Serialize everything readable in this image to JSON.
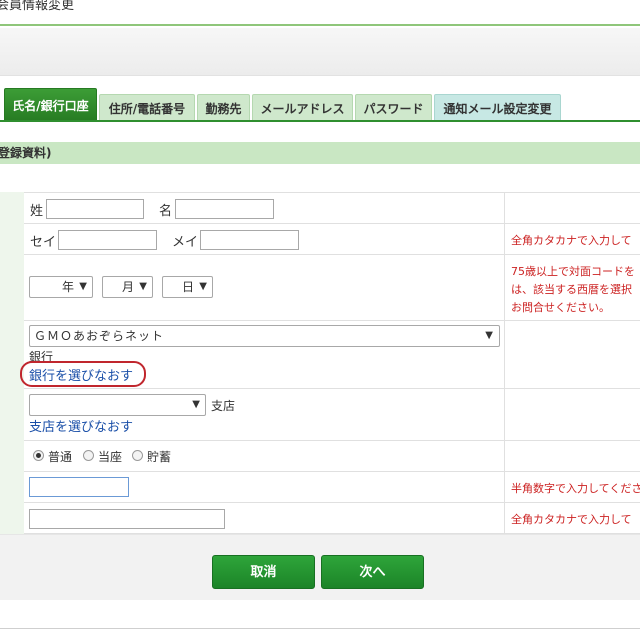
{
  "page": {
    "title": "会員情報変更"
  },
  "tabs": [
    {
      "label": "氏名/銀行口座",
      "active": true
    },
    {
      "label": "住所/電話番号"
    },
    {
      "label": "勤務先"
    },
    {
      "label": "メールアドレス"
    },
    {
      "label": "パスワード"
    },
    {
      "label": "通知メール設定変更"
    }
  ],
  "section": {
    "heading": "登録資料)"
  },
  "name_row": {
    "sei_label": "姓",
    "mei_label": "名",
    "sei_value": "",
    "mei_value": ""
  },
  "kana_row": {
    "sei_label": "セイ",
    "mei_label": "メイ",
    "note": "全角カタカナで入力して"
  },
  "birth_row": {
    "year_label": "年",
    "month_label": "月",
    "day_label": "日",
    "note_lines": [
      "75歳以上で対面コードを",
      "は、該当する西暦を選択",
      "お問合せください。"
    ]
  },
  "bank_row": {
    "bank_selected": "ＧＭＯあおぞらネット",
    "bank_suffix": "銀行",
    "reselect_bank_link": "銀行を選びなおす"
  },
  "branch_row": {
    "branch_selected": "",
    "branch_suffix": "支店",
    "reselect_branch_link": "支店を選びなおす"
  },
  "account_type_row": {
    "options": [
      "普通",
      "当座",
      "貯蓄"
    ],
    "selected": "普通"
  },
  "account_number_row": {
    "value": "",
    "note": "半角数字で入力してくださ"
  },
  "account_holder_row": {
    "value": "",
    "note": "全角カタカナで入力して"
  },
  "buttons": {
    "cancel": "取消",
    "next": "次へ"
  },
  "colors": {
    "accent": "#2ea53a",
    "tab_active": "#267a22",
    "note_red": "#cc2222",
    "link": "#1a4fa8"
  }
}
